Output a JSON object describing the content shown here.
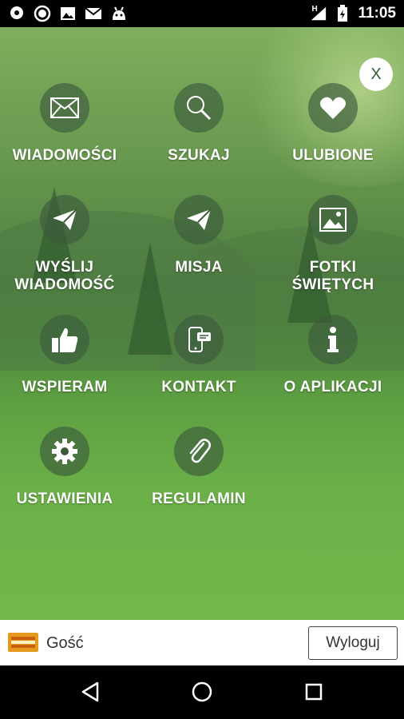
{
  "status_bar": {
    "time": "11:05",
    "network_label": "H",
    "icons_left": [
      "notification-icon",
      "messenger-icon",
      "image-icon",
      "mail-icon",
      "android-icon"
    ],
    "icons_right": [
      "signal-icon",
      "battery-icon"
    ]
  },
  "menu": {
    "close_label": "X",
    "items": [
      {
        "label": "WIADOMOŚCI",
        "icon": "mail-icon"
      },
      {
        "label": "SZUKAJ",
        "icon": "search-icon"
      },
      {
        "label": "ULUBIONE",
        "icon": "heart-icon"
      },
      {
        "label": "WYŚLIJ\nWIADOMOŚĆ",
        "icon": "paper-plane-icon"
      },
      {
        "label": "MISJA",
        "icon": "paper-plane-icon"
      },
      {
        "label": "FOTKI\nŚWIĘTYCH",
        "icon": "image-icon"
      },
      {
        "label": "WSPIERAM",
        "icon": "thumbs-up-icon"
      },
      {
        "label": "KONTAKT",
        "icon": "phone-message-icon"
      },
      {
        "label": "O APLIKACJI",
        "icon": "info-icon"
      },
      {
        "label": "USTAWIENIA",
        "icon": "gear-icon"
      },
      {
        "label": "REGULAMIN",
        "icon": "paperclip-icon"
      }
    ]
  },
  "user_bar": {
    "user_name": "Gość",
    "logout_label": "Wyloguj"
  },
  "nav_bar": {
    "buttons": [
      "back-icon",
      "home-icon",
      "recents-icon"
    ]
  }
}
